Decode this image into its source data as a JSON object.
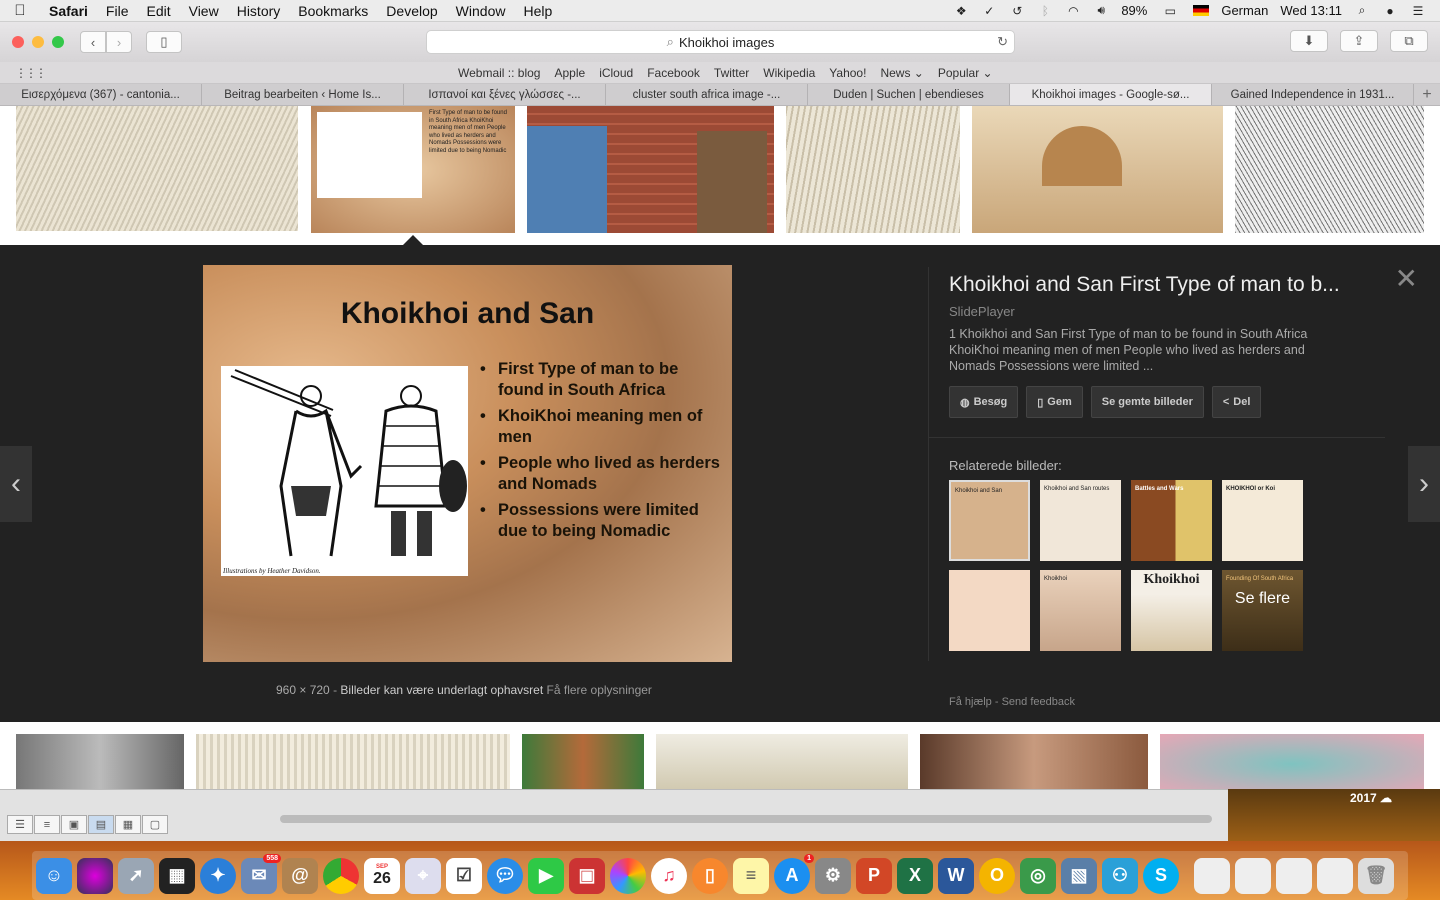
{
  "menubar": {
    "app": "Safari",
    "items": [
      "File",
      "Edit",
      "View",
      "History",
      "Bookmarks",
      "Develop",
      "Window",
      "Help"
    ],
    "battery": "89%",
    "input_source": "German",
    "clock": "Wed 13:11"
  },
  "toolbar": {
    "address": "Khoikhoi images"
  },
  "favorites": [
    "Webmail :: blog",
    "Apple",
    "iCloud",
    "Facebook",
    "Twitter",
    "Wikipedia",
    "Yahoo!",
    "News ⌄",
    "Popular ⌄"
  ],
  "tabs": [
    {
      "label": "Εισερχόμενα (367) - cantonia...",
      "active": false
    },
    {
      "label": "Beitrag bearbeiten ‹ Home Is...",
      "active": false
    },
    {
      "label": "Ισπανοί και ξένες γλώσσες -...",
      "active": false
    },
    {
      "label": "cluster south africa image -...",
      "active": false
    },
    {
      "label": "Duden | Suchen | ebendieses",
      "active": false
    },
    {
      "label": "Khoikhoi images - Google-sø...",
      "active": true
    },
    {
      "label": "Gained Independence in 1931...",
      "active": false
    }
  ],
  "thumb_caption": "First Type of man to be found in South Africa KhoiKhoi meaning men of men People who lived as herders and Nomads Possessions were limited due to being Nomadic",
  "preview": {
    "title": "Khoikhoi and San",
    "bullets": [
      "First Type of man to be found in South Africa",
      "KhoiKhoi meaning men of men",
      "People who lived as herders and Nomads",
      "Possessions were limited due to being Nomadic"
    ],
    "credit": "Illustrations by Heather Davidson.",
    "dimensions": "960 × 720",
    "copyright": "Billeder kan være underlagt ophavsret",
    "more_info": "Få flere oplysninger"
  },
  "info": {
    "title": "Khoikhoi and San First Type of man to b...",
    "source": "SlidePlayer",
    "description": "1 Khoikhoi and San First Type of man to be found in South Africa KhoiKhoi meaning men of men People who lived as herders and Nomads Possessions were limited ...",
    "buttons": {
      "visit": "Besøg",
      "save": "Gem",
      "view_saved": "Se gemte billeder",
      "share": "Del"
    },
    "related_label": "Relaterede billeder:",
    "related": [
      {
        "caption": "Khoikhoi and San"
      },
      {
        "caption": "Khoikhoi and San routes"
      },
      {
        "caption": "Battles and Wars"
      },
      {
        "caption": "KHOIKHOI or Koi"
      },
      {
        "caption": ""
      },
      {
        "caption": "Khoikhoi"
      },
      {
        "caption": "Khoikhoi"
      },
      {
        "caption": "Founding Of South Africa"
      }
    ],
    "more_label": "Se flere",
    "help": "Få hjælp",
    "feedback": "Send feedback"
  },
  "desktop": {
    "year": "2017"
  },
  "dock": {
    "mail_badge": "558",
    "calendar_month": "SEP",
    "calendar_day": "26",
    "appstore_badge": "1"
  },
  "colors": {
    "panel": "#222222",
    "dock": "#e58a24"
  }
}
